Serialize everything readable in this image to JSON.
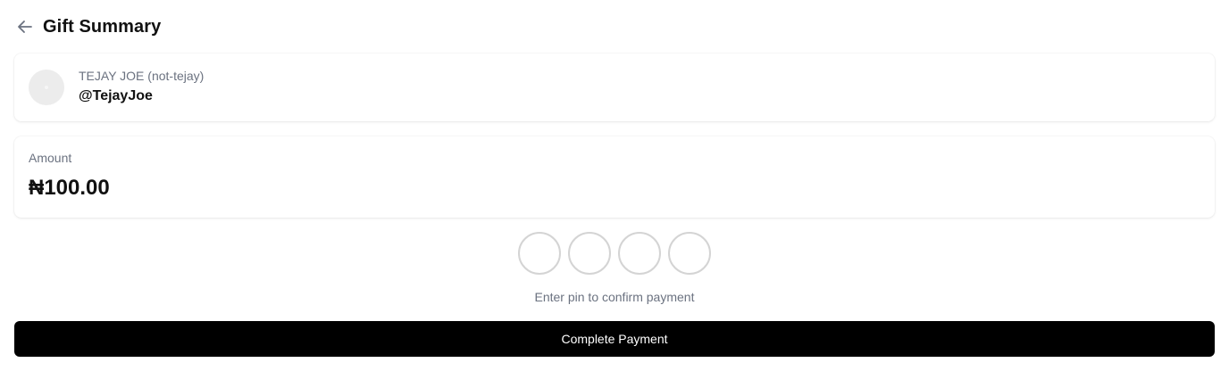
{
  "header": {
    "back_icon": "arrow-left-icon",
    "title": "Gift Summary"
  },
  "recipient": {
    "name": "TEJAY JOE (not-tejay)",
    "handle": "@TejayJoe",
    "avatar_icon": "avatar-placeholder"
  },
  "amount": {
    "label": "Amount",
    "value": "₦100.00"
  },
  "pin": {
    "length": 4,
    "digits": [
      "",
      "",
      "",
      ""
    ],
    "hint": "Enter pin to confirm payment"
  },
  "actions": {
    "complete_label": "Complete Payment"
  },
  "colors": {
    "primary_button": "#000000",
    "muted_text": "#6b7280",
    "pin_border": "#d4d4d4"
  }
}
